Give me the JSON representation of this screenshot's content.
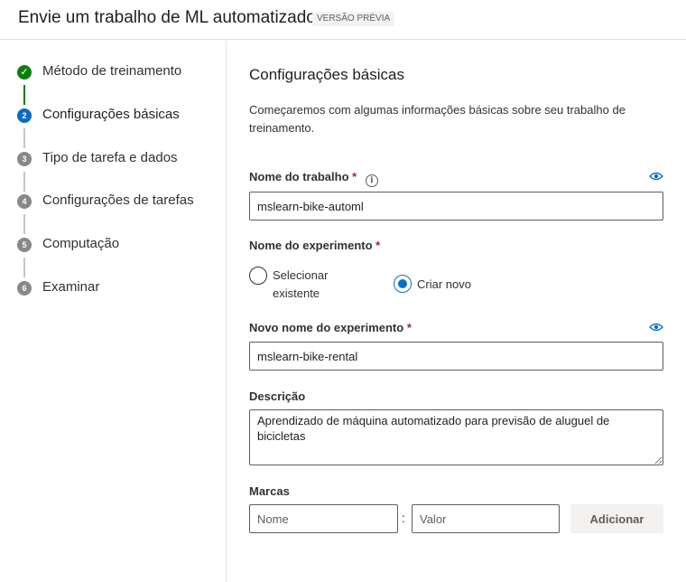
{
  "header": {
    "title": "Envie um trabalho de ML automatizado",
    "badge": "VERSÃO PRÉVIA"
  },
  "steps": [
    {
      "number": "✓",
      "label": "Método de treinamento",
      "state": "done"
    },
    {
      "number": "2",
      "label": "Configurações básicas",
      "state": "current"
    },
    {
      "number": "3",
      "label": "Tipo de tarefa e dados",
      "state": "pending"
    },
    {
      "number": "4",
      "label": "Configurações de tarefas",
      "state": "pending"
    },
    {
      "number": "5",
      "label": "Computação",
      "state": "pending"
    },
    {
      "number": "6",
      "label": "Examinar",
      "state": "pending"
    }
  ],
  "main": {
    "title": "Configurações básicas",
    "intro": "Começaremos com algumas informações básicas sobre seu trabalho de treinamento.",
    "job_name": {
      "label": "Nome do trabalho",
      "required": "*",
      "info_icon": "i",
      "value": "mslearn-bike-automl"
    },
    "experiment": {
      "label": "Nome do experimento",
      "required": "*",
      "options": [
        {
          "label_line1": "Selecionar",
          "label_line2": "existente",
          "selected": false
        },
        {
          "label": "Criar novo",
          "selected": true
        }
      ]
    },
    "new_experiment": {
      "label": "Novo nome do experimento",
      "required": "*",
      "value": "mslearn-bike-rental"
    },
    "description": {
      "label": "Descrição",
      "value": "Aprendizado de máquina automatizado para previsão de aluguel de bicicletas"
    },
    "tags": {
      "label": "Marcas",
      "name_placeholder": "Nome",
      "separator": ":",
      "value_placeholder": "Valor",
      "add_label": "Adicionar"
    }
  },
  "colors": {
    "accent": "#0f6cbd",
    "done": "#107c10",
    "required": "#a4262c"
  },
  "icons": {
    "done": "checkmark-icon",
    "info": "info-icon",
    "visibility": "eye-icon"
  }
}
